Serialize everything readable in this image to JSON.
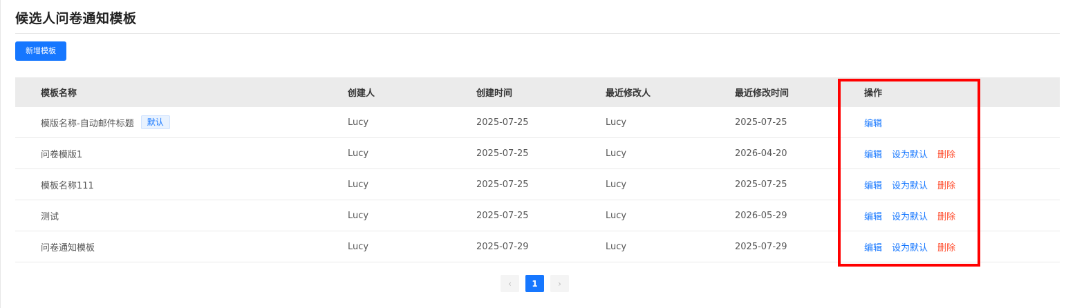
{
  "page": {
    "title": "候选人问卷通知模板"
  },
  "toolbar": {
    "add_label": "新增模板"
  },
  "table": {
    "columns": [
      "模板名称",
      "创建人",
      "创建时间",
      "最近修改人",
      "最近修改时间",
      "操作"
    ],
    "rows": [
      {
        "name": "模版名称-自动邮件标题",
        "tag": "默认",
        "creator": "Lucy",
        "created": "2025-07-25",
        "modifier": "Lucy",
        "modified": "2025-07-25"
      },
      {
        "name": "问卷模版1",
        "creator": "Lucy",
        "created": "2025-07-25",
        "modifier": "Lucy",
        "modified": "2026-04-20"
      },
      {
        "name": "模板名称111",
        "creator": "Lucy",
        "created": "2025-07-25",
        "modifier": "Lucy",
        "modified": "2025-07-25"
      },
      {
        "name": "测试",
        "creator": "Lucy",
        "created": "2025-07-25",
        "modifier": "Lucy",
        "modified": "2026-05-29"
      },
      {
        "name": "问卷通知模板",
        "creator": "Lucy",
        "created": "2025-07-29",
        "modifier": "Lucy",
        "modified": "2025-07-29"
      }
    ],
    "actions": {
      "edit": "编辑",
      "set_default": "设为默认",
      "delete": "删除"
    }
  },
  "pagination": {
    "prev": "‹",
    "current": "1",
    "next": "›"
  },
  "colors": {
    "primary": "#1677ff",
    "danger": "#ff4d2e",
    "highlight": "#ff0000"
  }
}
